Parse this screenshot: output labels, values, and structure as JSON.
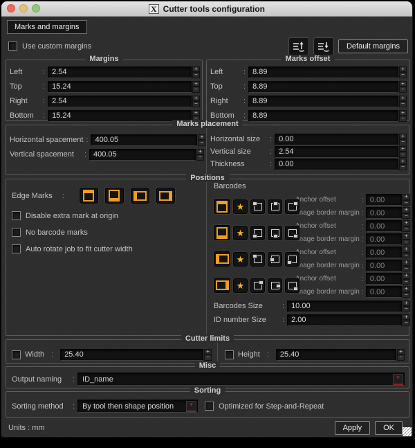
{
  "ui": {
    "colon": ":"
  },
  "icons": {
    "plus": "+",
    "minus": "−",
    "star": "★",
    "dropdown": "▼",
    "window_system_logo": "X"
  },
  "colors": {
    "accent_orange": "#f09d28",
    "star_yellow": "#f2b52e",
    "dropdown_arrow": "#8e2424",
    "window_bg": "#2d2d2d",
    "field_bg": "#121212"
  },
  "window": {
    "title": "Cutter tools configuration"
  },
  "tab_label": "Marks and margins",
  "header": {
    "use_custom_margins_label": "Use custom margins",
    "default_margins_label": "Default margins"
  },
  "margins": {
    "title": "Margins",
    "rows": [
      {
        "label": "Left",
        "value": "2.54"
      },
      {
        "label": "Top",
        "value": "15.24"
      },
      {
        "label": "Right",
        "value": "2.54"
      },
      {
        "label": "Bottom",
        "value": "15.24"
      }
    ]
  },
  "marks_offset": {
    "title": "Marks offset",
    "rows": [
      {
        "label": "Left",
        "value": "8.89"
      },
      {
        "label": "Top",
        "value": "8.89"
      },
      {
        "label": "Right",
        "value": "8.89"
      },
      {
        "label": "Bottom",
        "value": "8.89"
      }
    ]
  },
  "marks_placement": {
    "title": "Marks placement",
    "left_rows": [
      {
        "label": "Horizontal spacement",
        "value": "400.05"
      },
      {
        "label": "Vertical spacement",
        "value": "400.05"
      }
    ],
    "right_rows": [
      {
        "label": "Horizontal size",
        "value": "0.00"
      },
      {
        "label": "Vertical size",
        "value": "2.54"
      },
      {
        "label": "Thickness",
        "value": "0.00"
      }
    ]
  },
  "positions": {
    "title": "Positions",
    "edge_marks_label": "Edge Marks",
    "checkboxes": [
      "Disable extra mark at origin",
      "No barcode marks",
      "Auto rotate job to fit cutter width"
    ],
    "barcodes_label": "Barcodes",
    "barcode_rows": [
      {
        "anchor_label": "Anchor offset",
        "anchor_value": "0.00",
        "margin_label": "Image border margin",
        "margin_value": "0.00"
      },
      {
        "anchor_label": "Anchor offset",
        "anchor_value": "0.00",
        "margin_label": "Image border margin",
        "margin_value": "0.00"
      },
      {
        "anchor_label": "Anchor offset",
        "anchor_value": "0.00",
        "margin_label": "Image border margin",
        "margin_value": "0.00"
      },
      {
        "anchor_label": "Anchor offset",
        "anchor_value": "0.00",
        "margin_label": "Image border margin",
        "margin_value": "0.00"
      }
    ],
    "barcodes_size_label": "Barcodes Size",
    "barcodes_size_value": "10.00",
    "id_number_size_label": "ID number Size",
    "id_number_size_value": "2.00"
  },
  "cutter_limits": {
    "title": "Cutter limits",
    "width_label": "Width",
    "width_value": "25.40",
    "height_label": "Height",
    "height_value": "25.40"
  },
  "misc": {
    "title": "Misc",
    "output_naming_label": "Output naming",
    "output_naming_value": "ID_name"
  },
  "sorting": {
    "title": "Sorting",
    "method_label": "Sorting method",
    "method_value": "By tool then shape position",
    "optimized_label": "Optimized for Step-and-Repeat"
  },
  "footer": {
    "units": "Units : mm",
    "apply_label": "Apply",
    "ok_label": "OK"
  }
}
